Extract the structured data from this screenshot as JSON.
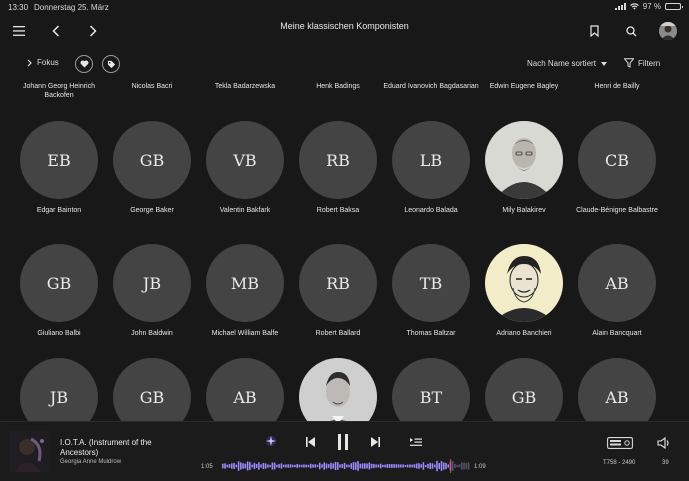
{
  "status": {
    "time": "13:30",
    "date": "Donnerstag 25. März",
    "battery": "97 %",
    "battery_level": 0.97
  },
  "header": {
    "title": "Meine klassischen Komponisten"
  },
  "filterbar": {
    "fokus": "Fokus",
    "sort": "Nach Name sortiert",
    "filter": "Filtern"
  },
  "top_row": [
    "Johann Georg Heinrich Backofen",
    "Nicolas Bacri",
    "Tekla Badarzewska",
    "Henk Badings",
    "Eduard Ivanovich Bagdasarian",
    "Edwin Eugene Bagley",
    "Henri de Bailly"
  ],
  "rows": [
    [
      {
        "initials": "EB",
        "name": "Edgar Bainton"
      },
      {
        "initials": "GB",
        "name": "George Baker"
      },
      {
        "initials": "VB",
        "name": "Valentin Bakfark"
      },
      {
        "initials": "RB",
        "name": "Robert Baksa"
      },
      {
        "initials": "LB",
        "name": "Leonardo Balada"
      },
      {
        "initials": "",
        "name": "Mily Balakirev"
      },
      {
        "initials": "CB",
        "name": "Claude-Bénigne Balbastre"
      }
    ],
    [
      {
        "initials": "GB",
        "name": "Giuliano Balbi"
      },
      {
        "initials": "JB",
        "name": "John Baldwin"
      },
      {
        "initials": "MB",
        "name": "Michael William Balfe"
      },
      {
        "initials": "RB",
        "name": "Robert Ballard"
      },
      {
        "initials": "TB",
        "name": "Thomas Baltzar"
      },
      {
        "initials": "",
        "name": "Adriano Banchieri"
      },
      {
        "initials": "AB",
        "name": "Alain Bancquart"
      }
    ],
    [
      {
        "initials": "JB"
      },
      {
        "initials": "GB"
      },
      {
        "initials": "AB"
      },
      {
        "initials": ""
      },
      {
        "initials": "BT"
      },
      {
        "initials": "GB"
      },
      {
        "initials": "AB"
      }
    ]
  ],
  "player": {
    "track": "I.O.T.A. (Instrument of the Ancestors)",
    "artist": "Georgia Anne Muldrow",
    "elapsed": "1:05",
    "remaining": "1:09",
    "progress": 0.92,
    "device": "T758 - 2490",
    "volume": "39"
  },
  "colors": {
    "background": "#181818",
    "avatar": "#444444",
    "accent": "#9b8cff",
    "playhead": "#d9534f"
  }
}
